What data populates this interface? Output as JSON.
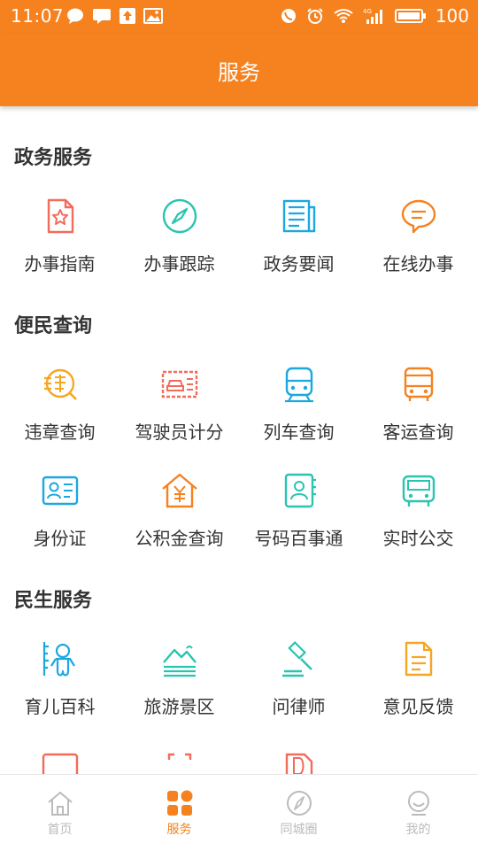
{
  "status_bar": {
    "time": "11:07",
    "battery": "100",
    "network": "4G"
  },
  "header": {
    "title": "服务"
  },
  "sections": [
    {
      "title": "政务服务",
      "items": [
        {
          "label": "办事指南",
          "icon": "guide-icon",
          "color": "#f26b5b"
        },
        {
          "label": "办事跟踪",
          "icon": "compass-icon",
          "color": "#2bc4b0"
        },
        {
          "label": "政务要闻",
          "icon": "news-icon",
          "color": "#1ba8e0"
        },
        {
          "label": "在线办事",
          "icon": "chat-icon",
          "color": "#f5821f"
        }
      ]
    },
    {
      "title": "便民查询",
      "items": [
        {
          "label": "违章查询",
          "icon": "violation-search-icon",
          "color": "#f5a623"
        },
        {
          "label": "驾驶员计分",
          "icon": "driver-card-icon",
          "color": "#f26b5b"
        },
        {
          "label": "列车查询",
          "icon": "train-icon",
          "color": "#1ba8e0"
        },
        {
          "label": "客运查询",
          "icon": "coach-icon",
          "color": "#f5821f"
        },
        {
          "label": "身份证",
          "icon": "id-card-icon",
          "color": "#1ba8e0"
        },
        {
          "label": "公积金查询",
          "icon": "fund-house-icon",
          "color": "#f5821f"
        },
        {
          "label": "号码百事通",
          "icon": "contacts-book-icon",
          "color": "#2bc4b0"
        },
        {
          "label": "实时公交",
          "icon": "bus-icon",
          "color": "#2bc4b0"
        }
      ]
    },
    {
      "title": "民生服务",
      "items": [
        {
          "label": "育儿百科",
          "icon": "baby-icon",
          "color": "#1ba8e0"
        },
        {
          "label": "旅游景区",
          "icon": "landscape-icon",
          "color": "#2bc4b0"
        },
        {
          "label": "问律师",
          "icon": "gavel-icon",
          "color": "#2bc4b0"
        },
        {
          "label": "意见反馈",
          "icon": "feedback-doc-icon",
          "color": "#f5a623"
        }
      ]
    }
  ],
  "tabs": [
    {
      "label": "首页",
      "icon": "home-icon",
      "active": false
    },
    {
      "label": "服务",
      "icon": "services-grid-icon",
      "active": true
    },
    {
      "label": "同城圈",
      "icon": "compass-icon",
      "active": false
    },
    {
      "label": "我的",
      "icon": "profile-icon",
      "active": false
    }
  ],
  "colors": {
    "accent": "#f5821f",
    "text": "#333333",
    "tab_inactive": "#bbbbbb"
  }
}
